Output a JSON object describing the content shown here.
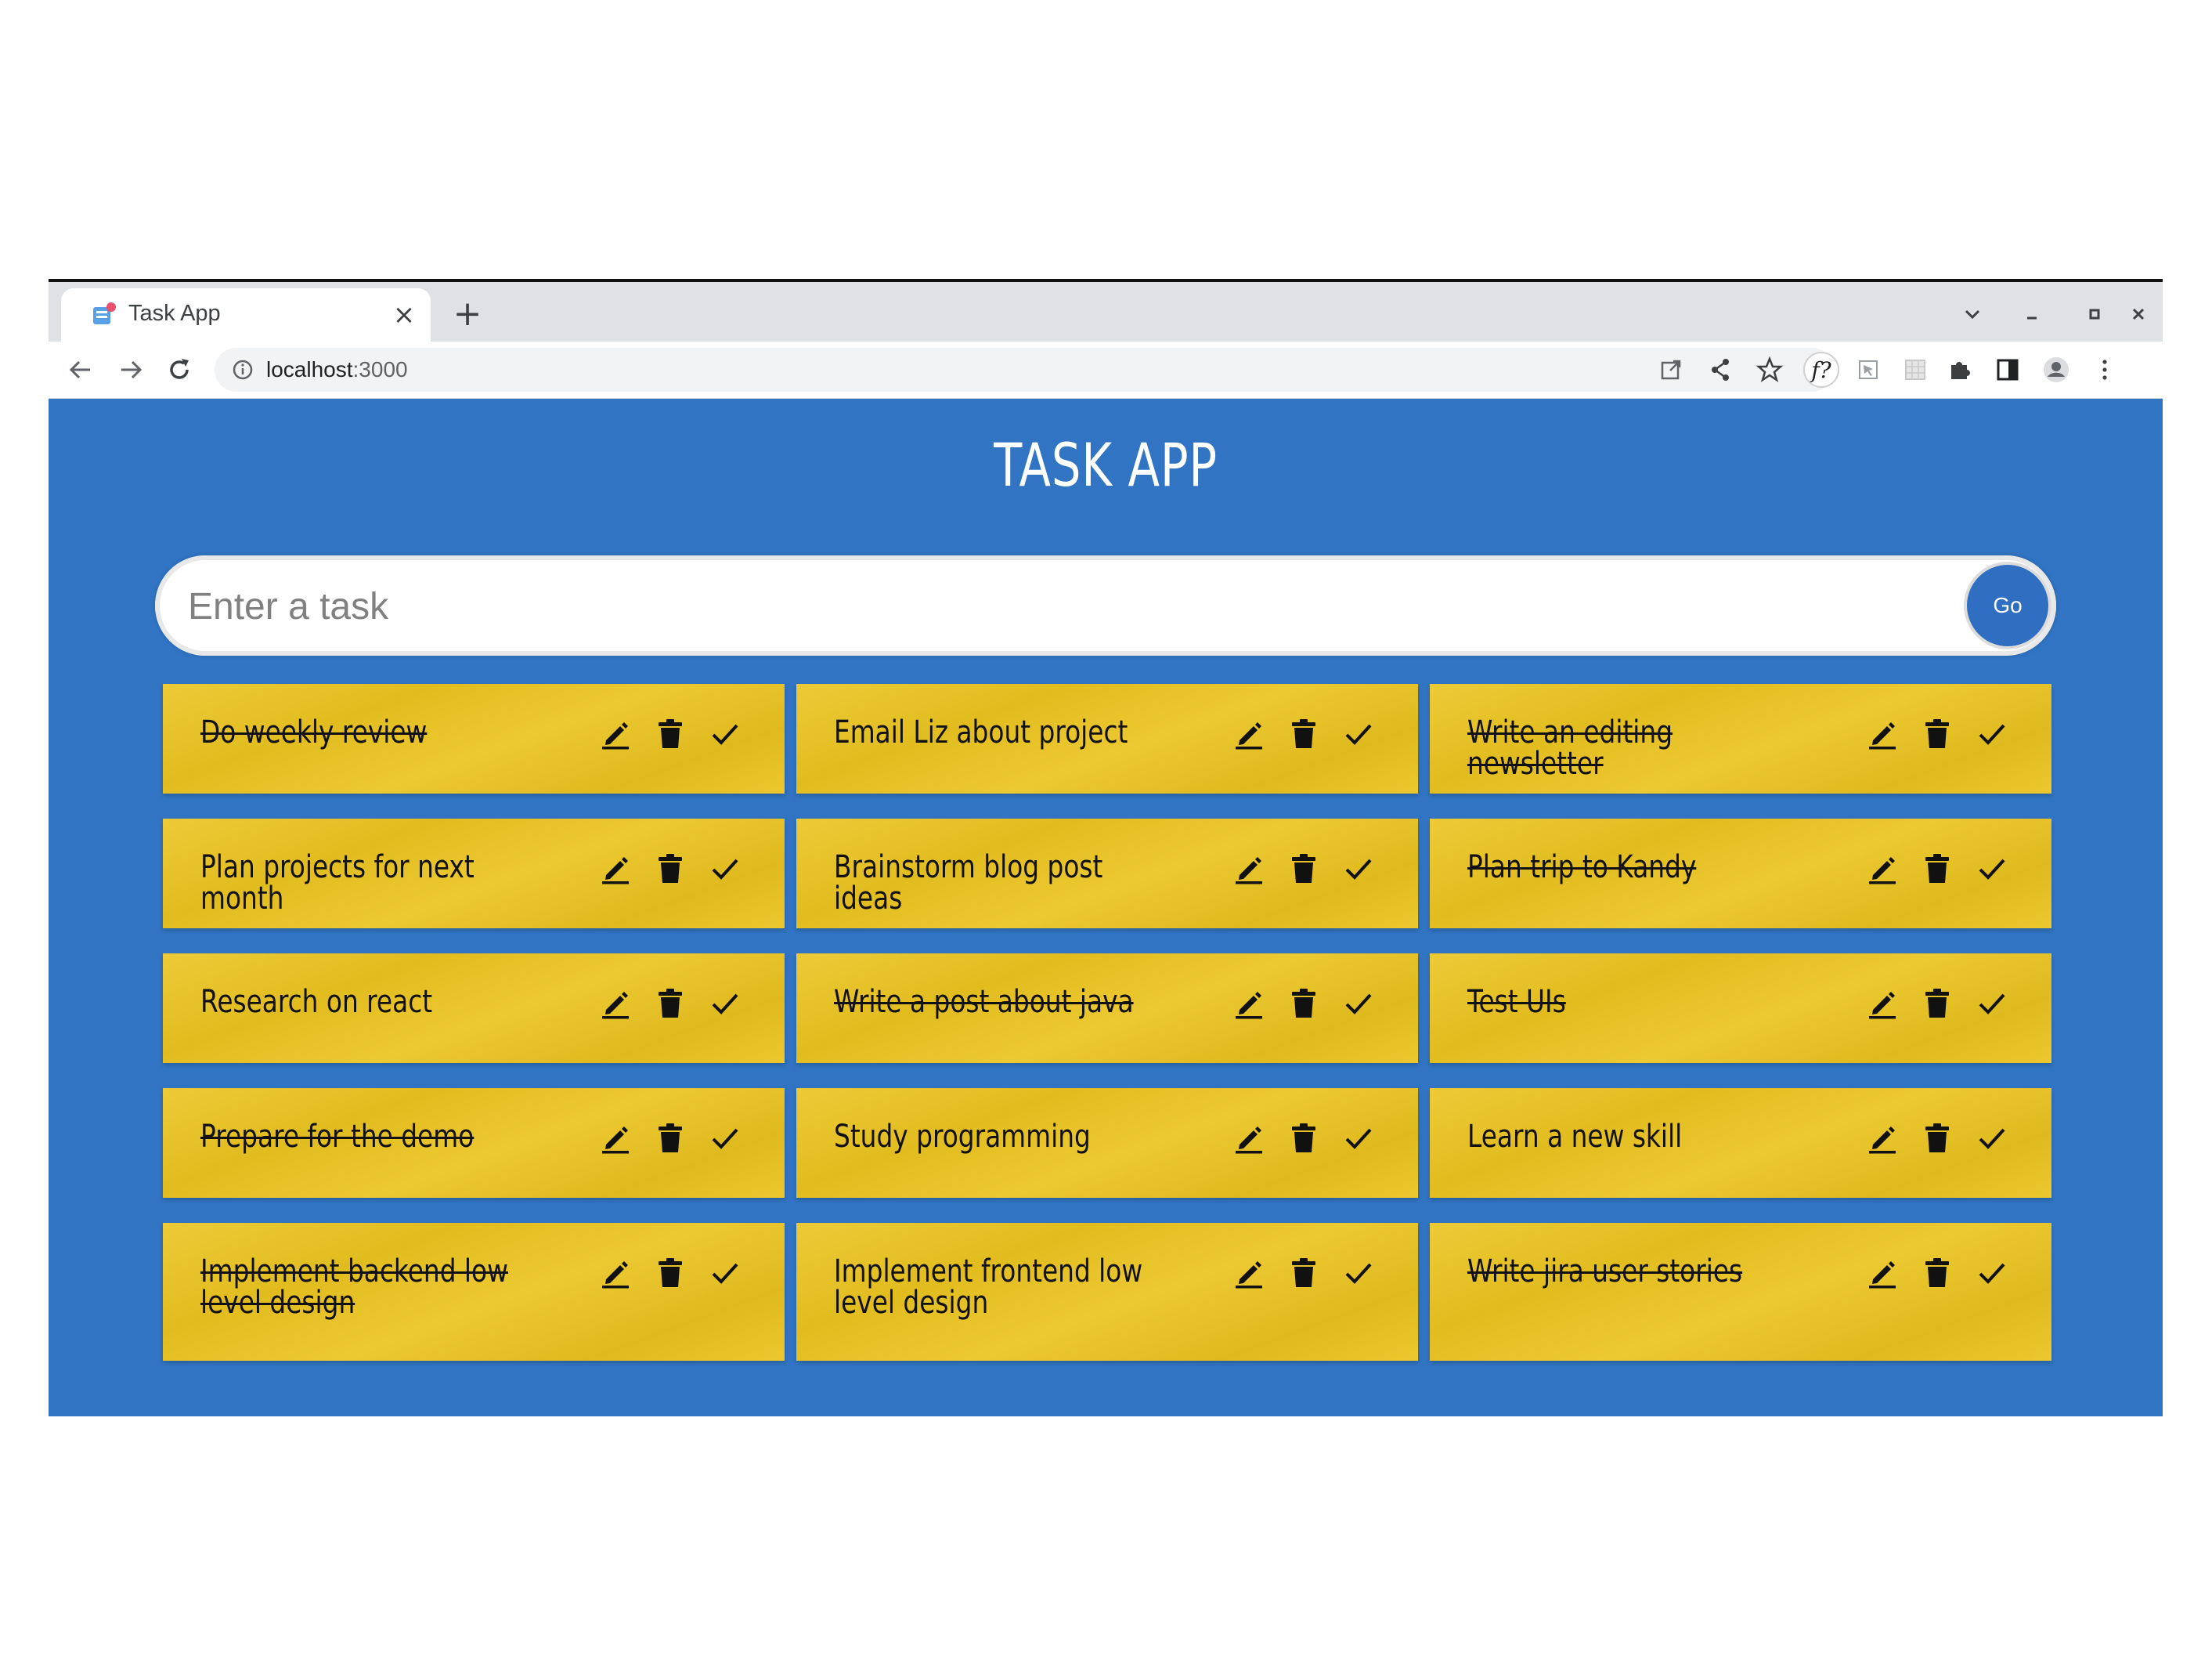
{
  "browser": {
    "tab_title": "Task App",
    "tab_close": "×",
    "new_tab": "+",
    "url_host": "localhost",
    "url_port": ":3000"
  },
  "app": {
    "title": "TASK APP",
    "input_placeholder": "Enter a task",
    "go_label": "Go"
  },
  "tasks": [
    {
      "text": "Do weekly review",
      "done": true
    },
    {
      "text": "Email Liz about project",
      "done": false
    },
    {
      "text": "Write an editing newsletter",
      "done": true
    },
    {
      "text": "Plan projects for next month",
      "done": false
    },
    {
      "text": "Brainstorm blog post ideas",
      "done": false
    },
    {
      "text": "Plan trip to Kandy",
      "done": true
    },
    {
      "text": "Research on react",
      "done": false
    },
    {
      "text": "Write a post about java",
      "done": true
    },
    {
      "text": "Test UIs",
      "done": true
    },
    {
      "text": "Prepare for the demo",
      "done": true
    },
    {
      "text": "Study programming",
      "done": false
    },
    {
      "text": "Learn a new skill",
      "done": false
    },
    {
      "text": "Implement backend low level design",
      "done": true
    },
    {
      "text": "Implement frontend low level design",
      "done": false
    },
    {
      "text": "Write jira user stories",
      "done": true
    }
  ],
  "colors": {
    "page_background": "#3174c3",
    "card": "#ebc420",
    "go_button": "#2f6ec0"
  },
  "icons": [
    "edit-icon",
    "delete-icon",
    "complete-icon"
  ]
}
